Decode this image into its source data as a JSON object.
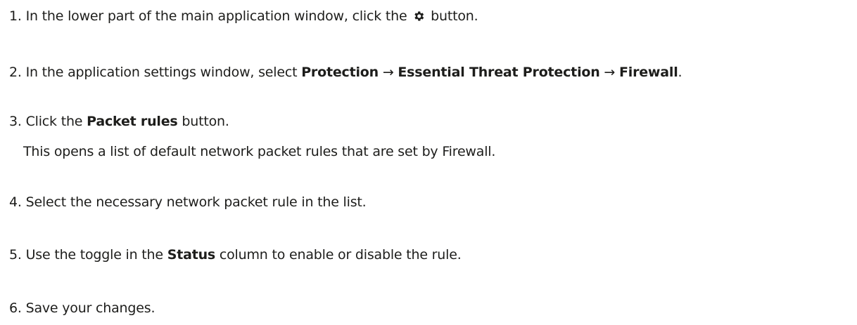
{
  "steps": [
    {
      "number": "1.",
      "text_before": "In the lower part of the main application window, click the",
      "icon": "gear-icon",
      "text_after": "button."
    },
    {
      "number": "2.",
      "text_before": "In the application settings window, select",
      "path": [
        "Protection",
        "Essential Threat Protection",
        "Firewall"
      ],
      "arrow": "→",
      "text_after": "."
    },
    {
      "number": "3.",
      "text_before": "Click the",
      "bold": "Packet rules",
      "text_after": "button.",
      "note": "This opens a list of default network packet rules that are set by Firewall."
    },
    {
      "number": "4.",
      "text": "Select the necessary network packet rule in the list."
    },
    {
      "number": "5.",
      "text_before": "Use the toggle in the",
      "bold": "Status",
      "text_after": "column to enable or disable the rule."
    },
    {
      "number": "6.",
      "text": "Save your changes."
    }
  ]
}
